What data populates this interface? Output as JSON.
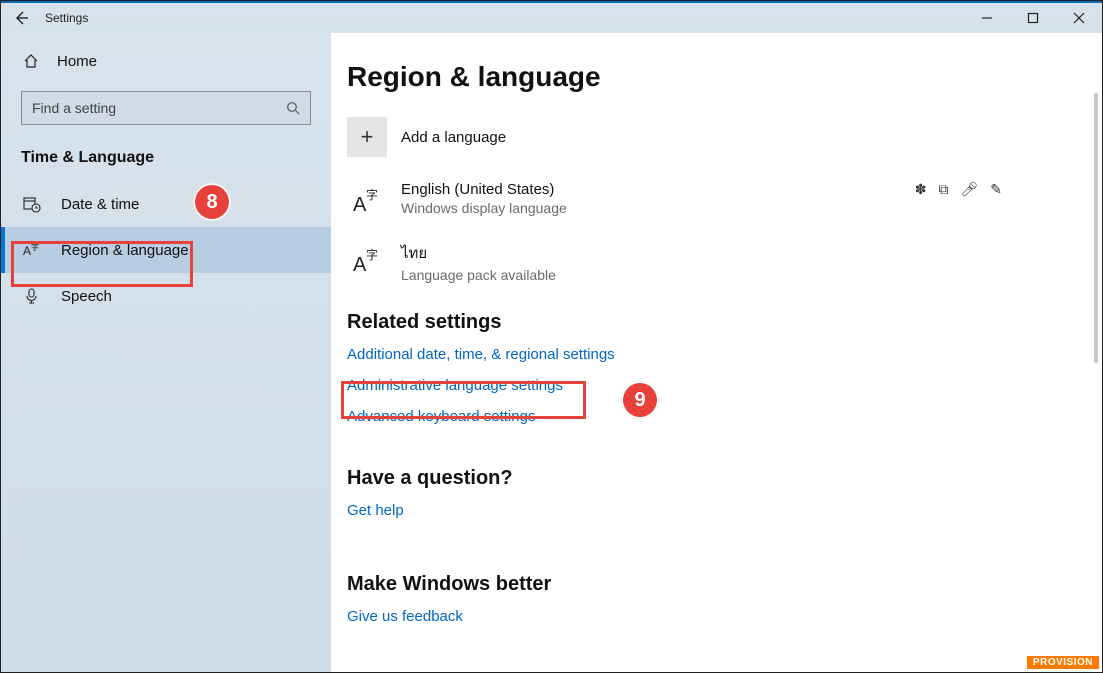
{
  "window": {
    "title": "Settings"
  },
  "sidebar": {
    "home": "Home",
    "search_placeholder": "Find a setting",
    "category": "Time & Language",
    "items": [
      {
        "label": "Date & time"
      },
      {
        "label": "Region & language"
      },
      {
        "label": "Speech"
      }
    ]
  },
  "page": {
    "title": "Region & language",
    "add_lang": "Add a language",
    "languages": [
      {
        "name": "English (United States)",
        "sub": "Windows display language"
      },
      {
        "name": "ไทย",
        "sub": "Language pack available"
      }
    ],
    "related_h": "Related settings",
    "links": [
      "Additional date, time, & regional settings",
      "Administrative language settings",
      "Advanced keyboard settings"
    ],
    "question_h": "Have a question?",
    "get_help": "Get help",
    "better_h": "Make Windows better",
    "feedback": "Give us feedback"
  },
  "annotations": {
    "c8": "8",
    "c9": "9"
  },
  "watermark": "PROVISION"
}
